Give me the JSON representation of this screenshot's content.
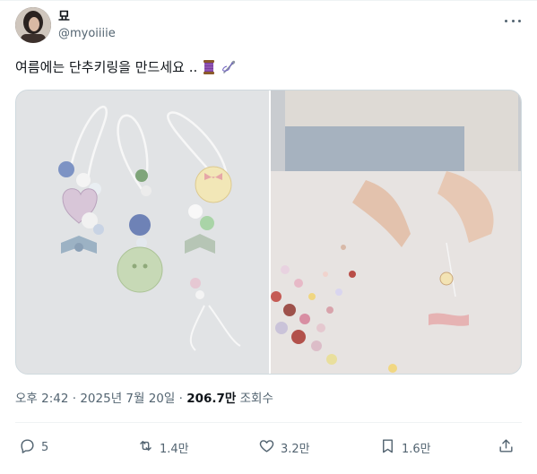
{
  "post": {
    "display_name": "묘",
    "handle": "@myoiiiie",
    "text": "여름에는 단추키링을 만드세요 ..",
    "emojis": [
      "thread-spool-emoji",
      "needle-emoji"
    ],
    "more_icon": "more-dots-icon"
  },
  "meta": {
    "time": "오후 2:42",
    "sep1": "·",
    "date": "2025년 7월 20일",
    "sep2": "·",
    "views_count": "206.7만",
    "views_label": "조회수"
  },
  "actions": {
    "reply_count": "5",
    "repost_count": "1.4만",
    "like_count": "3.2만",
    "bookmark_count": "1.6만",
    "icons": [
      "reply-icon",
      "repost-icon",
      "like-icon",
      "bookmark-icon",
      "share-icon"
    ]
  },
  "colors": {
    "text_primary": "#0f1419",
    "text_secondary": "#536471",
    "border": "#cfd9de"
  }
}
